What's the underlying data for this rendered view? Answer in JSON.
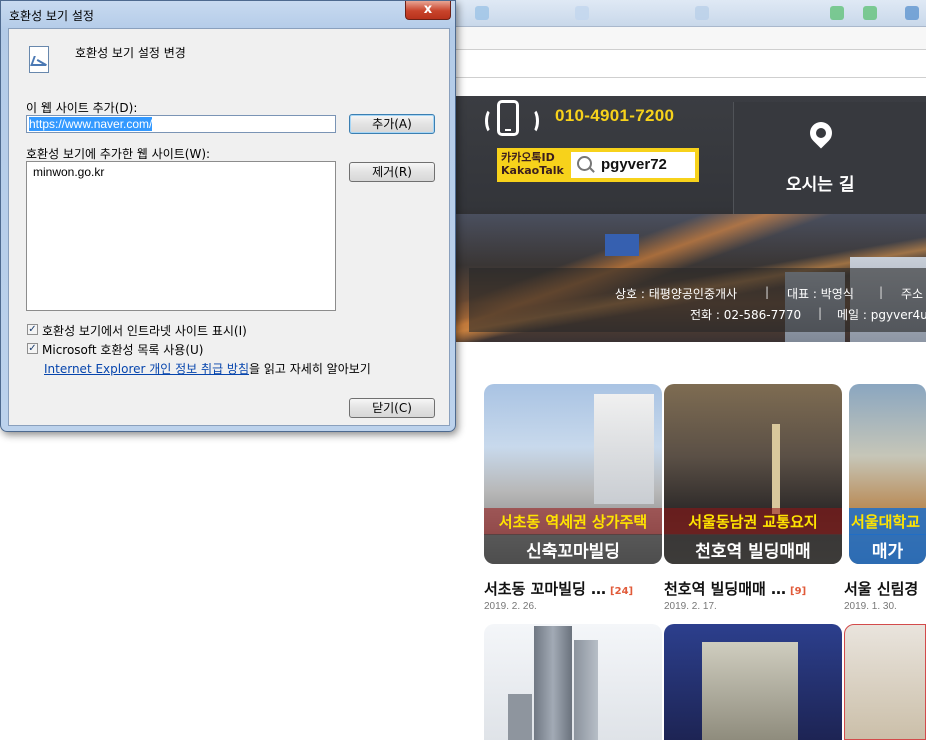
{
  "dialog": {
    "title": "호환성 보기 설정",
    "close_glyph": "x",
    "heading": "호환성 보기 설정 변경",
    "add_site_label": "이 웹 사이트 추가(D):",
    "add_site_value": "https://www.naver.com/",
    "add_button": "추가(A)",
    "sites_label": "호환성 보기에 추가한 웹 사이트(W):",
    "sites": [
      "minwon.go.kr"
    ],
    "remove_button": "제거(R)",
    "intranet_checkbox": {
      "label": "호환성 보기에서 인트라넷 사이트 표시(I)",
      "checked": true
    },
    "ms_list_checkbox": {
      "label": "Microsoft 호환성 목록 사용(U)",
      "checked": true
    },
    "privacy_link": "Internet Explorer 개인 정보 취급 방침",
    "privacy_suffix": "을 읽고 자세히 알아보기",
    "close_button": "닫기(C)"
  },
  "site": {
    "phone": "010-4901-7200",
    "kakao_label_line1": "카카오톡ID",
    "kakao_label_line2": "KakaoTalk",
    "kakao_id": "pgyver72",
    "directions": "오시는 길",
    "footer": {
      "company": "상호 : 태평양공인중개사",
      "ceo": "대표 : 박영식",
      "address": "주소",
      "tel": "전화 : 02-586-7770",
      "email": "메일 : pgyver4u"
    },
    "listings": [
      {
        "caption1": "서초동 역세권 상가주택",
        "caption2": "신축꼬마빌딩",
        "title": "서초동 꼬마빌딩 …",
        "count": "[24]",
        "date": "2019. 2. 26."
      },
      {
        "caption1": "서울동남권 교통요지",
        "caption2": "천호역 빌딩매매",
        "title": "천호역 빌딩매매 …",
        "count": "[9]",
        "date": "2019. 2. 17."
      },
      {
        "caption1": "서울대학교",
        "caption2": "매가",
        "title": "서울 신림경",
        "count": "",
        "date": "2019. 1. 30."
      }
    ]
  },
  "colors": {
    "accent_yellow": "#f7d21b",
    "link_blue": "#0645ad",
    "count_red": "#e15b3a"
  }
}
